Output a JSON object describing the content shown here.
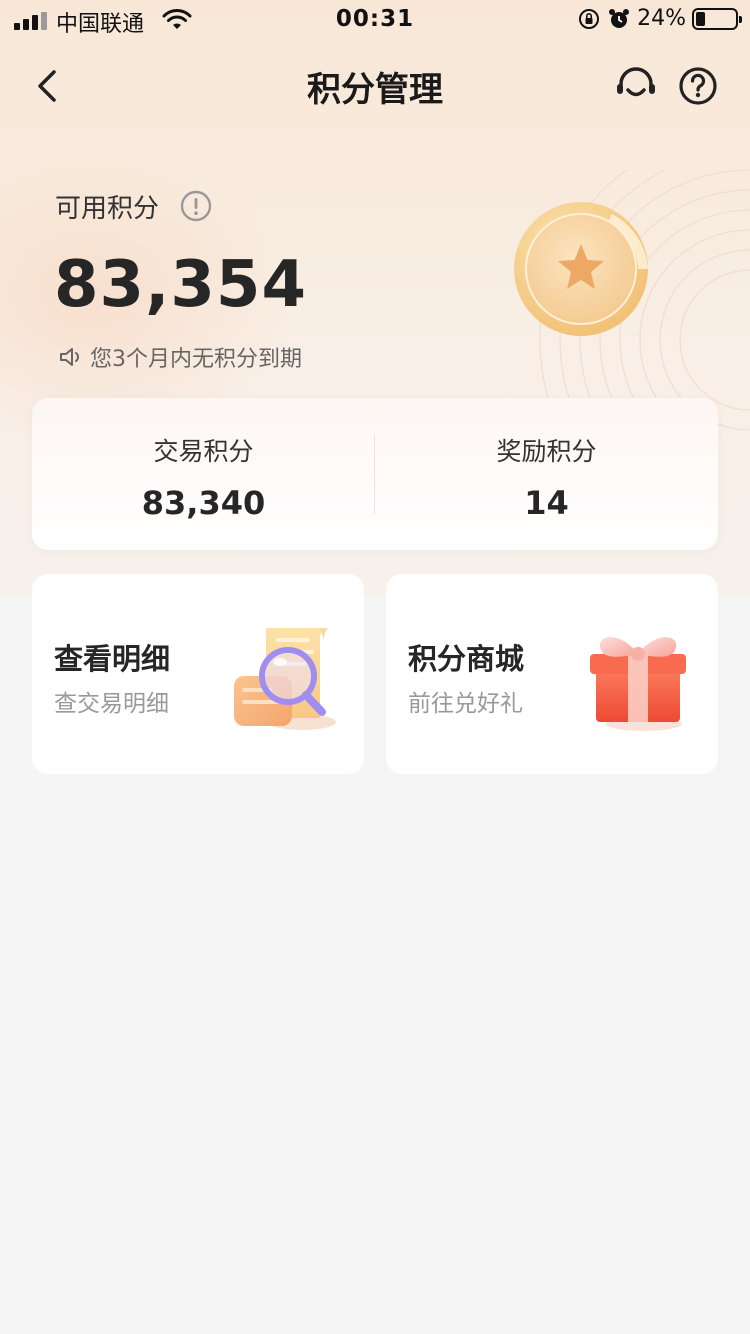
{
  "status_bar": {
    "carrier": "中国联通",
    "time": "00:31",
    "battery_percent": "24%",
    "battery_level": 0.24,
    "icons": [
      "signal-icon",
      "wifi-icon",
      "orientation-lock-icon",
      "alarm-icon",
      "battery-icon"
    ]
  },
  "nav": {
    "title": "积分管理",
    "icons": [
      "back-arrow-icon",
      "customer-service-icon",
      "help-icon"
    ]
  },
  "points": {
    "available_label": "可用积分",
    "available_value": "83,354",
    "expire_notice": "您3个月内无积分到期",
    "icons": [
      "info-icon",
      "speaker-icon",
      "medal-star-icon"
    ]
  },
  "split": {
    "trade_label": "交易积分",
    "trade_value": "83,340",
    "reward_label": "奖励积分",
    "reward_value": "14"
  },
  "tiles": {
    "detail": {
      "title": "查看明细",
      "subtitle": "查交易明细",
      "icon": "magnifier-document-icon"
    },
    "mall": {
      "title": "积分商城",
      "subtitle": "前往兑好礼",
      "icon": "gift-box-icon"
    }
  },
  "colors": {
    "hero_top": "#f8e7d7",
    "page_bg": "#f5f5f5",
    "medal_gold": "#f3c987",
    "gift_red": "#f0553a"
  }
}
